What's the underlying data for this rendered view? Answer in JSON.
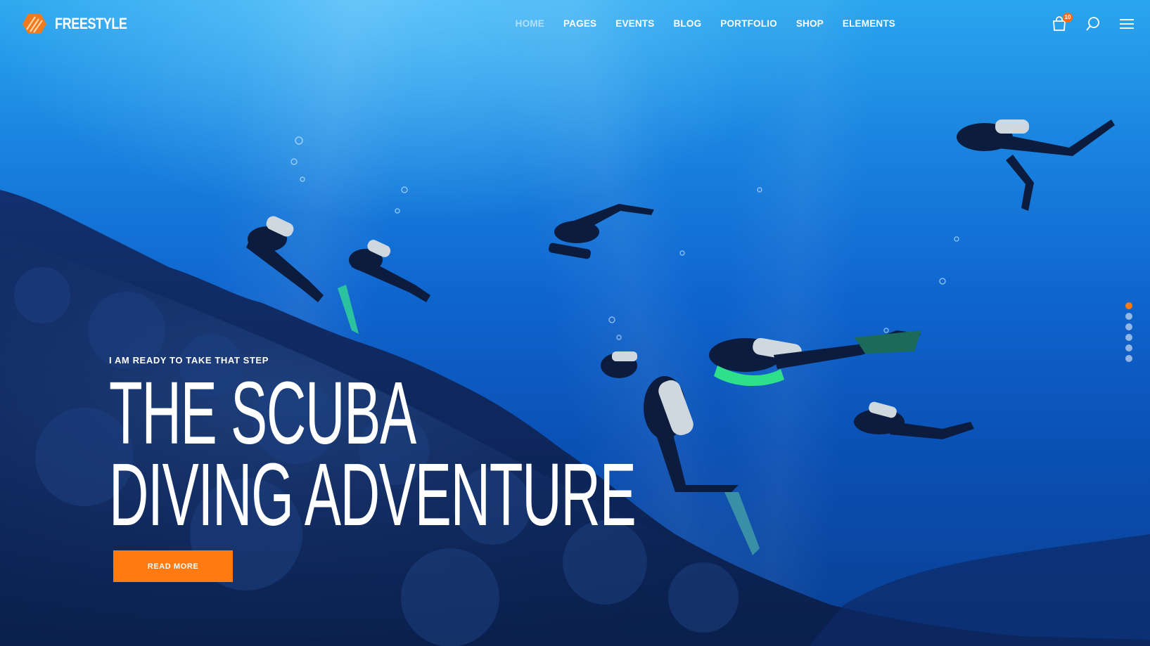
{
  "brand": {
    "name": "FREESTYLE",
    "accent_color": "#ff7a10"
  },
  "nav": {
    "items": [
      {
        "label": "HOME",
        "active": true
      },
      {
        "label": "PAGES",
        "active": false
      },
      {
        "label": "EVENTS",
        "active": false
      },
      {
        "label": "BLOG",
        "active": false
      },
      {
        "label": "PORTFOLIO",
        "active": false
      },
      {
        "label": "SHOP",
        "active": false
      },
      {
        "label": "ELEMENTS",
        "active": false
      }
    ],
    "cart_count": "10",
    "icons": [
      "cart-icon",
      "search-icon",
      "hamburger-menu-icon"
    ]
  },
  "hero": {
    "eyebrow": "I AM READY TO TAKE THAT STEP",
    "headline_line1": "THE SCUBA",
    "headline_line2": "DIVING ADVENTURE",
    "cta_label": "READ MORE",
    "background": "underwater photo of scuba divers above a coral reef"
  },
  "slider": {
    "slide_count": 6,
    "active_index": 0
  }
}
